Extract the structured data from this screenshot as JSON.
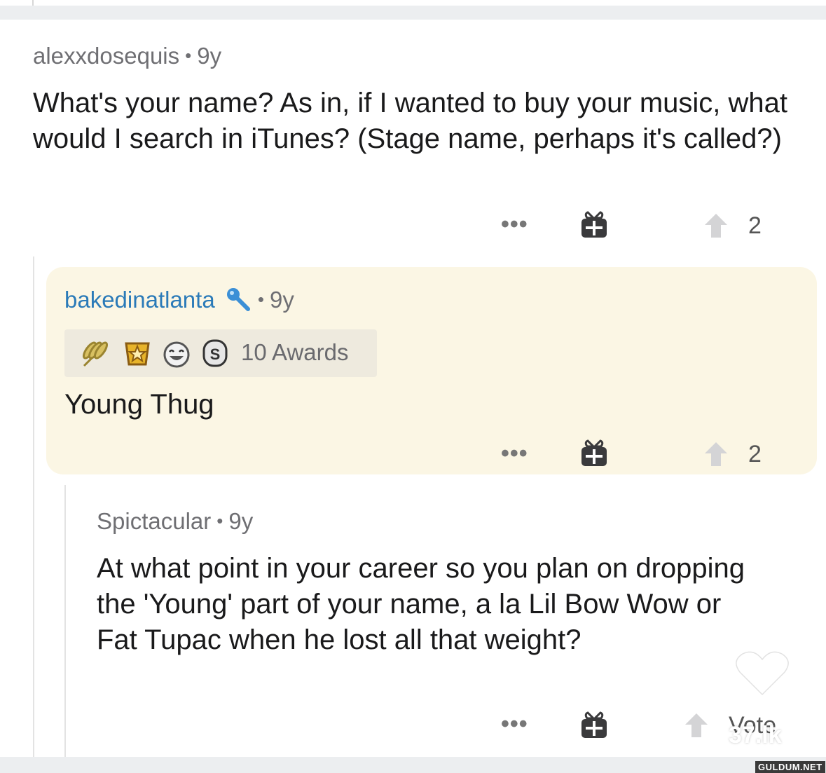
{
  "comments": [
    {
      "username": "alexxdosequis",
      "age": "9y",
      "body": "What's your name? As in, if I wanted to buy your music, what would I search in iTunes? (Stage name, perhaps it's called?)",
      "votes": "2"
    },
    {
      "username": "bakedinatlanta",
      "flair_icon": "microphone-icon",
      "age": "9y",
      "awards_label": "10 Awards",
      "award_icons": [
        "wheat-award-icon",
        "gold-award-icon",
        "laughing-face-award-icon",
        "silver-coin-award-icon"
      ],
      "body": "Young Thug",
      "votes": "2",
      "highlight_color": "#fbf6e4"
    },
    {
      "username": "Spictacular",
      "age": "9y",
      "body": "At what point in your career so you plan on dropping the 'Young' part of your name, a la Lil Bow Wow or Fat Tupac when he lost all that weight?",
      "votes": "Vote"
    }
  ],
  "actions": {
    "more_glyph": "•••"
  },
  "separator": "•",
  "watermarks": {
    "site1": "37.lk",
    "site2": "GULDUM.NET"
  },
  "colors": {
    "op_username": "#2a7ab8",
    "meta": "#6f6f73",
    "background": "#ffffff"
  }
}
